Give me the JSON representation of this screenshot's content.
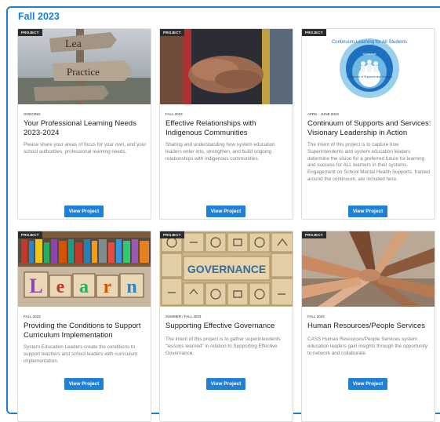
{
  "section": {
    "title": "Fall 2023"
  },
  "cards": [
    {
      "tag": "PROJECT",
      "date": "ONGOING",
      "title": "Your Professional Learning Needs 2023-2024",
      "description": "Please share your areas of focus for your own, and your school authorities, professional learning needs.",
      "button": "View Project",
      "image_text": {
        "sign_top": "Lea",
        "sign_mid": "Practice"
      }
    },
    {
      "tag": "PROJECT",
      "date": "FALL 2023",
      "title": "Effective Relationships with Indigenous Communities",
      "description": "Sharing and understanding how system education leaders enter into, strengthen, and build ongoing relationships with indigenous communities.",
      "button": "View Project"
    },
    {
      "tag": "PROJECT",
      "date": "APRIL - JUNE 2024",
      "title": "Continuum of Supports and Services: Visionary Leadership in Action",
      "description": "The intent of this project is to capture how Superintendents and system education leaders determine the vision for a preferred future for learning and success for ALL learners in their systems. Engagement on School Mental Health Supports, framed around the continuum, are included here.",
      "button": "View Project",
      "image_text": {
        "arc": "Continuum Learning for All Students",
        "inner": "Universal",
        "center": "Continuum of Supports and Services"
      }
    },
    {
      "tag": "PROJECT",
      "date": "FALL 2023",
      "title": "Providing the Conditions to Support Curriculum Implementation",
      "description": "System Education Leaders create the conditions to support teachers and school leaders with curriculum implementation.",
      "button": "View Project",
      "image_text": {
        "blocks": [
          "L",
          "e",
          "a",
          "r",
          "n"
        ]
      }
    },
    {
      "tag": "PROJECT",
      "date": "SUMMER / FALL 2023",
      "title": "Supporting Effective Governance",
      "description": "The intent of this project is to gather superintendents \"lessons learned\" in relation to Supporting Effective Governance.",
      "button": "View Project",
      "image_text": {
        "center": "GOVERNANCE"
      }
    },
    {
      "tag": "PROJECT",
      "date": "FALL 2023",
      "title": "Human Resources/People Services",
      "description": "CASS Human Resources/People Services system education leaders gain insights through the opportunity to network and collaborate.",
      "button": "View Project"
    }
  ],
  "colors": {
    "accent": "#1a7fd4",
    "button": "#1f80d6",
    "tag_bg": "#2b2b2b"
  }
}
